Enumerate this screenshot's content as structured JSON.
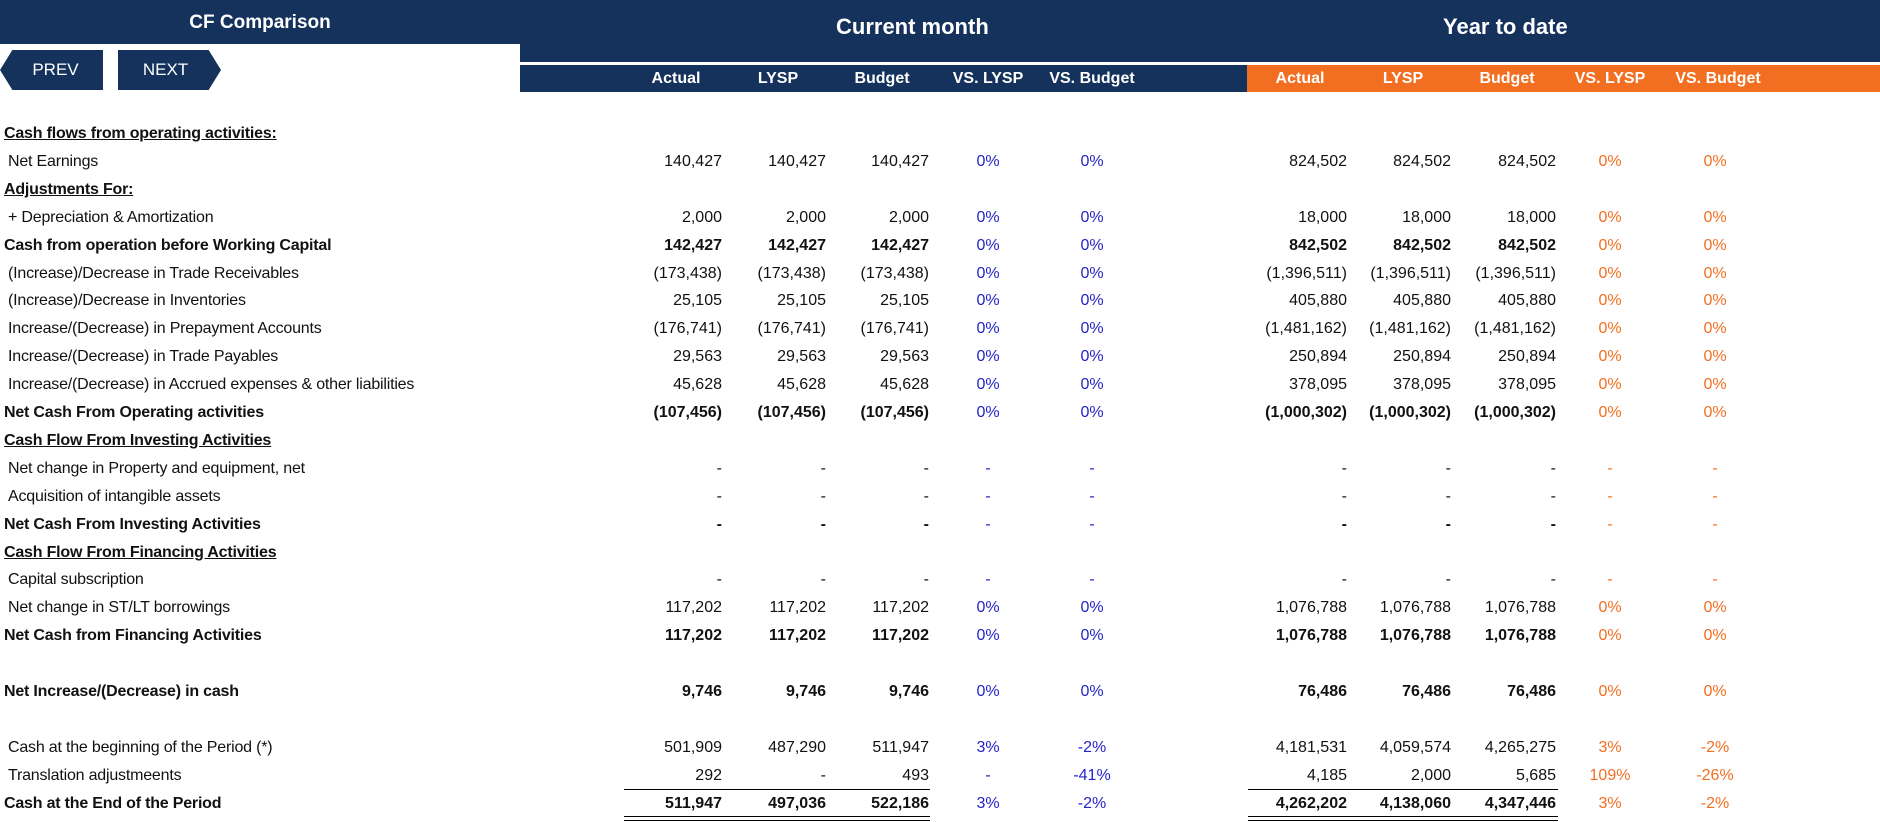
{
  "header": {
    "title": "CF Comparison",
    "prev_label": "PREV",
    "next_label": "NEXT",
    "current_month": "Current month",
    "year_to_date": "Year to date",
    "columns": [
      "Actual",
      "LYSP",
      "Budget",
      "VS. LYSP",
      "VS. Budget"
    ]
  },
  "colors": {
    "navy": "#14325c",
    "orange": "#f26f21",
    "blue_pct": "#2323c8"
  },
  "rows": [
    {
      "label": "Cash flows from operating activities:",
      "style": "section"
    },
    {
      "label": "Net Earnings",
      "style": "item",
      "cm": [
        "140,427",
        "140,427",
        "140,427",
        "0%",
        "0%"
      ],
      "ytd": [
        "824,502",
        "824,502",
        "824,502",
        "0%",
        "0%"
      ]
    },
    {
      "label": "Adjustments For:",
      "style": "section"
    },
    {
      "label": "+ Depreciation & Amortization",
      "style": "item",
      "cm": [
        "2,000",
        "2,000",
        "2,000",
        "0%",
        "0%"
      ],
      "ytd": [
        "18,000",
        "18,000",
        "18,000",
        "0%",
        "0%"
      ]
    },
    {
      "label": "Cash from operation before Working Capital",
      "style": "bold",
      "cm": [
        "142,427",
        "142,427",
        "142,427",
        "0%",
        "0%"
      ],
      "ytd": [
        "842,502",
        "842,502",
        "842,502",
        "0%",
        "0%"
      ]
    },
    {
      "label": "(Increase)/Decrease in Trade Receivables",
      "style": "item",
      "cm": [
        "(173,438)",
        "(173,438)",
        "(173,438)",
        "0%",
        "0%"
      ],
      "ytd": [
        "(1,396,511)",
        "(1,396,511)",
        "(1,396,511)",
        "0%",
        "0%"
      ]
    },
    {
      "label": "(Increase)/Decrease in Inventories",
      "style": "item",
      "cm": [
        "25,105",
        "25,105",
        "25,105",
        "0%",
        "0%"
      ],
      "ytd": [
        "405,880",
        "405,880",
        "405,880",
        "0%",
        "0%"
      ]
    },
    {
      "label": "Increase/(Decrease) in Prepayment Accounts",
      "style": "item",
      "cm": [
        "(176,741)",
        "(176,741)",
        "(176,741)",
        "0%",
        "0%"
      ],
      "ytd": [
        "(1,481,162)",
        "(1,481,162)",
        "(1,481,162)",
        "0%",
        "0%"
      ]
    },
    {
      "label": "Increase/(Decrease) in Trade Payables",
      "style": "item",
      "cm": [
        "29,563",
        "29,563",
        "29,563",
        "0%",
        "0%"
      ],
      "ytd": [
        "250,894",
        "250,894",
        "250,894",
        "0%",
        "0%"
      ]
    },
    {
      "label": "Increase/(Decrease) in Accrued expenses & other liabilities",
      "style": "item",
      "cm": [
        "45,628",
        "45,628",
        "45,628",
        "0%",
        "0%"
      ],
      "ytd": [
        "378,095",
        "378,095",
        "378,095",
        "0%",
        "0%"
      ]
    },
    {
      "label": "Net Cash From Operating activities",
      "style": "bold",
      "cm": [
        "(107,456)",
        "(107,456)",
        "(107,456)",
        "0%",
        "0%"
      ],
      "ytd": [
        "(1,000,302)",
        "(1,000,302)",
        "(1,000,302)",
        "0%",
        "0%"
      ]
    },
    {
      "label": "Cash Flow From Investing Activities",
      "style": "section"
    },
    {
      "label": "Net change in Property and equipment, net",
      "style": "item",
      "cm": [
        "-",
        "-",
        "-",
        "-",
        "-"
      ],
      "ytd": [
        "-",
        "-",
        "-",
        "-",
        "-"
      ]
    },
    {
      "label": "Acquisition of intangible assets",
      "style": "item",
      "cm": [
        "-",
        "-",
        "-",
        "-",
        "-"
      ],
      "ytd": [
        "-",
        "-",
        "-",
        "-",
        "-"
      ]
    },
    {
      "label": "Net Cash From Investing Activities",
      "style": "bold",
      "cm": [
        "-",
        "-",
        "-",
        "-",
        "-"
      ],
      "ytd": [
        "-",
        "-",
        "-",
        "-",
        "-"
      ]
    },
    {
      "label": "Cash Flow From Financing Activities",
      "style": "section"
    },
    {
      "label": "Capital subscription",
      "style": "item",
      "cm": [
        "-",
        "-",
        "-",
        "-",
        "-"
      ],
      "ytd": [
        "-",
        "-",
        "-",
        "-",
        "-"
      ]
    },
    {
      "label": "Net change in ST/LT borrowings",
      "style": "item",
      "cm": [
        "117,202",
        "117,202",
        "117,202",
        "0%",
        "0%"
      ],
      "ytd": [
        "1,076,788",
        "1,076,788",
        "1,076,788",
        "0%",
        "0%"
      ]
    },
    {
      "label": "Net Cash from Financing Activities",
      "style": "bold",
      "cm": [
        "117,202",
        "117,202",
        "117,202",
        "0%",
        "0%"
      ],
      "ytd": [
        "1,076,788",
        "1,076,788",
        "1,076,788",
        "0%",
        "0%"
      ]
    },
    {
      "label": "",
      "style": "blank"
    },
    {
      "label": "Net Increase/(Decrease) in cash",
      "style": "bold",
      "cm": [
        "9,746",
        "9,746",
        "9,746",
        "0%",
        "0%"
      ],
      "ytd": [
        "76,486",
        "76,486",
        "76,486",
        "0%",
        "0%"
      ]
    },
    {
      "label": "",
      "style": "blank"
    },
    {
      "label": "Cash at the beginning of the Period (*)",
      "style": "item",
      "cm": [
        "501,909",
        "487,290",
        "511,947",
        "3%",
        "-2%"
      ],
      "ytd": [
        "4,181,531",
        "4,059,574",
        "4,265,275",
        "3%",
        "-2%"
      ]
    },
    {
      "label": "Translation adjustmeents",
      "style": "item",
      "cm": [
        "292",
        "-",
        "493",
        "-",
        "-41%"
      ],
      "ytd": [
        "4,185",
        "2,000",
        "5,685",
        "109%",
        "-26%"
      ]
    },
    {
      "label": "Cash at the End of the Period",
      "style": "total",
      "cm": [
        "511,947",
        "497,036",
        "522,186",
        "3%",
        "-2%"
      ],
      "ytd": [
        "4,262,202",
        "4,138,060",
        "4,347,446",
        "3%",
        "-2%"
      ]
    }
  ]
}
